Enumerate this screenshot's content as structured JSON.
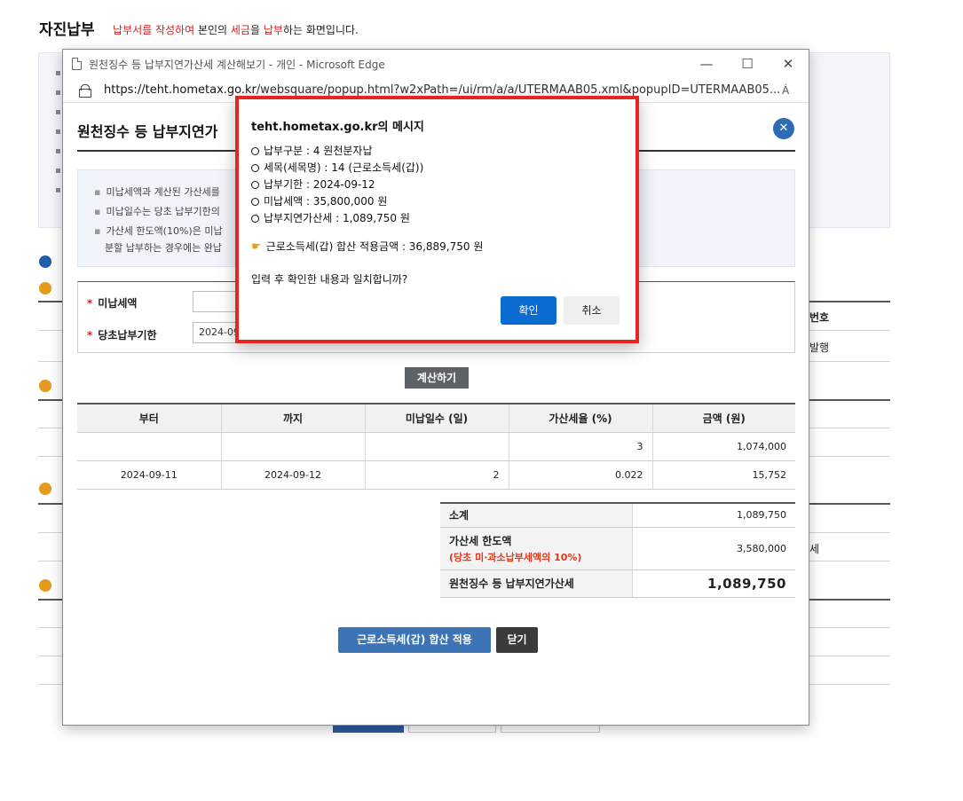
{
  "page": {
    "title": "자진납부",
    "subtitle_parts": [
      "납부서를 작성하여",
      " 본인의 ",
      "세금",
      "을 ",
      "납부",
      "하는 화면입니다."
    ],
    "side_texts": [
      "번호",
      "발행",
      "세"
    ]
  },
  "window": {
    "title": "원천징수 등 납부지연가산세 계산해보기 - 개인 - Microsoft Edge",
    "controls": {
      "minimize": "—",
      "maximize": "☐",
      "close": "✕"
    },
    "url_host": "https://teht.hometax.go.kr",
    "url_path": "/websquare/popup.html?w2xPath=/ui/rm/a/a/UTERMAAB05.xml&popupID=UTERMAAB05...",
    "read_aloud": "Á"
  },
  "popup": {
    "title": "원천징수 등 납부지연가",
    "close_symbol": "✕",
    "info": [
      "미납세액과 계산된 가산세를",
      "미납일수는 당초 납부기한의",
      "가산세 한도액(10%)은 미납",
      "분할 납부하는 경우에는 완납"
    ],
    "form": {
      "unpaid_label": "미납세액",
      "unpaid_value": "",
      "due_label": "당초납부기한",
      "due_value": "2024-09"
    },
    "calc_button": "계산하기",
    "table": {
      "headers": [
        "부터",
        "까지",
        "미납일수 (일)",
        "가산세율 (%)",
        "금액 (원)"
      ],
      "rows": [
        [
          "",
          "",
          "",
          "3",
          "1,074,000"
        ],
        [
          "2024-09-11",
          "2024-09-12",
          "2",
          "0.022",
          "15,752"
        ]
      ]
    },
    "summary": {
      "subtotal_label": "소계",
      "subtotal_value": "1,089,750",
      "limit_label": "가산세 한도액",
      "limit_note": "(당초 미·과소납부세액의 10%)",
      "limit_value": "3,580,000",
      "total_label": "원천징수 등 납부지연가산세",
      "total_value": "1,089,750"
    },
    "apply_button": "근로소득세(갑) 합산 적용",
    "close_button": "닫기"
  },
  "dialog": {
    "title": "teht.hometax.go.kr의 메시지",
    "lines": [
      "납부구분 : 4 원천분자납",
      "세목(세목명) : 14 (근로소득세(갑))",
      "납부기한 : 2024-09-12",
      "미납세액 : 35,800,000 원",
      "납부지연가산세 : 1,089,750 원"
    ],
    "applied_line": "근로소득세(갑) 합산 적용금액 : 36,889,750 원",
    "question": "입력 후 확인한 내용과 일치합니까?",
    "ok": "확인",
    "cancel": "취소"
  }
}
